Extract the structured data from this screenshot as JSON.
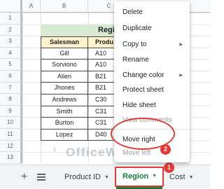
{
  "columns": [
    "A",
    "B",
    "C"
  ],
  "rows": [
    "1",
    "2",
    "3",
    "4",
    "5",
    "6",
    "7",
    "8",
    "9",
    "10",
    "11",
    "12",
    "13"
  ],
  "title_cell": "Regi",
  "table": {
    "headers": [
      "Salesman",
      "Produ"
    ],
    "rows": [
      [
        "Gill",
        "A10"
      ],
      [
        "Sorviono",
        "A10"
      ],
      [
        "Alien",
        "B21"
      ],
      [
        "Jhones",
        "B21"
      ],
      [
        "Andrews",
        "C30"
      ],
      [
        "Smith",
        "C31"
      ],
      [
        "Burton",
        "C31"
      ],
      [
        "Lopez",
        "D40"
      ]
    ]
  },
  "faint_mark": "1",
  "watermark": "OfficeWheel",
  "tabbar": {
    "add_sheet_icon": "+",
    "tabs": [
      {
        "label": "Product ID",
        "active": false
      },
      {
        "label": "Region",
        "active": true
      },
      {
        "label": "Cost",
        "active": false
      }
    ]
  },
  "context_menu": {
    "items": [
      {
        "label": "Delete",
        "enabled": true,
        "submenu": false
      },
      {
        "label": "Duplicate",
        "enabled": true,
        "submenu": false
      },
      {
        "label": "Copy to",
        "enabled": true,
        "submenu": true
      },
      {
        "label": "Rename",
        "enabled": true,
        "submenu": false
      },
      {
        "label": "Change color",
        "enabled": true,
        "submenu": true
      },
      {
        "label": "Protect sheet",
        "enabled": true,
        "submenu": false
      },
      {
        "label": "Hide sheet",
        "enabled": true,
        "submenu": false
      },
      {
        "label": "View comments",
        "enabled": false,
        "submenu": false
      },
      {
        "label": "Move right",
        "enabled": true,
        "submenu": false
      },
      {
        "label": "Move left",
        "enabled": false,
        "submenu": false
      }
    ]
  },
  "annotations": {
    "step1": "1",
    "step2": "2",
    "color": "#e53935"
  },
  "colors": {
    "active_tab_text": "#188038",
    "title_fill": "#d9ead3",
    "header_fill": "#fff2cc"
  }
}
